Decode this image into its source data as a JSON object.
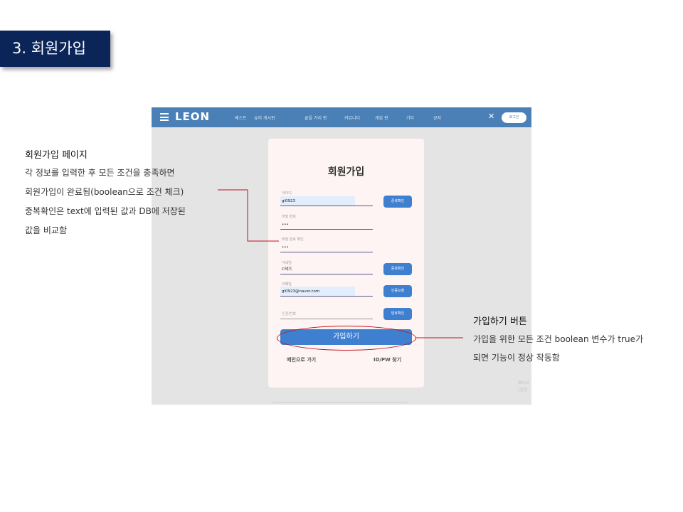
{
  "slide": {
    "title": "3. 회원가입"
  },
  "app": {
    "logo": "LEON",
    "nav": [
      "베스트",
      "유머 게시판",
      "끝을 거리 판",
      "커뮤니티",
      "게임 판",
      "기타",
      "공지"
    ],
    "login": "로그인"
  },
  "form": {
    "title": "회원가입",
    "fields": [
      {
        "label": "아이디",
        "value": "gl0923",
        "button": "중복확인"
      },
      {
        "label": "비밀 번호",
        "value": "•••"
      },
      {
        "label": "비밀 번호 확인",
        "value": "•••"
      },
      {
        "label": "닉네임",
        "value": "C레기",
        "button": "중복확인"
      },
      {
        "label": "이메일",
        "value": "gl0923@naver.com",
        "button": "인증요청"
      },
      {
        "label": "",
        "value": "",
        "placeholder": "인증번호",
        "button": "번호확인"
      }
    ],
    "submit": "가입하기",
    "back_link": "메인으로 가기",
    "find_link": "ID/PW 찾기"
  },
  "watermark": [
    "Wind",
    "[설정"
  ],
  "annotations": {
    "left": {
      "title": "회원가입 페이지",
      "lines": [
        "각 정보를 입력한 후 모든 조건을 충족하면",
        "회원가입이 완료됨(boolean으로 조건 체크)",
        "중복확인은 text에 입력된 값과 DB에 저장된",
        "값을 비교함"
      ]
    },
    "right": {
      "title": "가입하기 버튼",
      "lines": [
        "가입을 위한 모든 조건 boolean 변수가 true가",
        "되면 기능이 정상 작동함"
      ]
    }
  },
  "colors": {
    "navy": "#0b2559",
    "nav_blue": "#4a80b6",
    "button_blue": "#3f7fd0",
    "callout_red": "#c0121f"
  }
}
